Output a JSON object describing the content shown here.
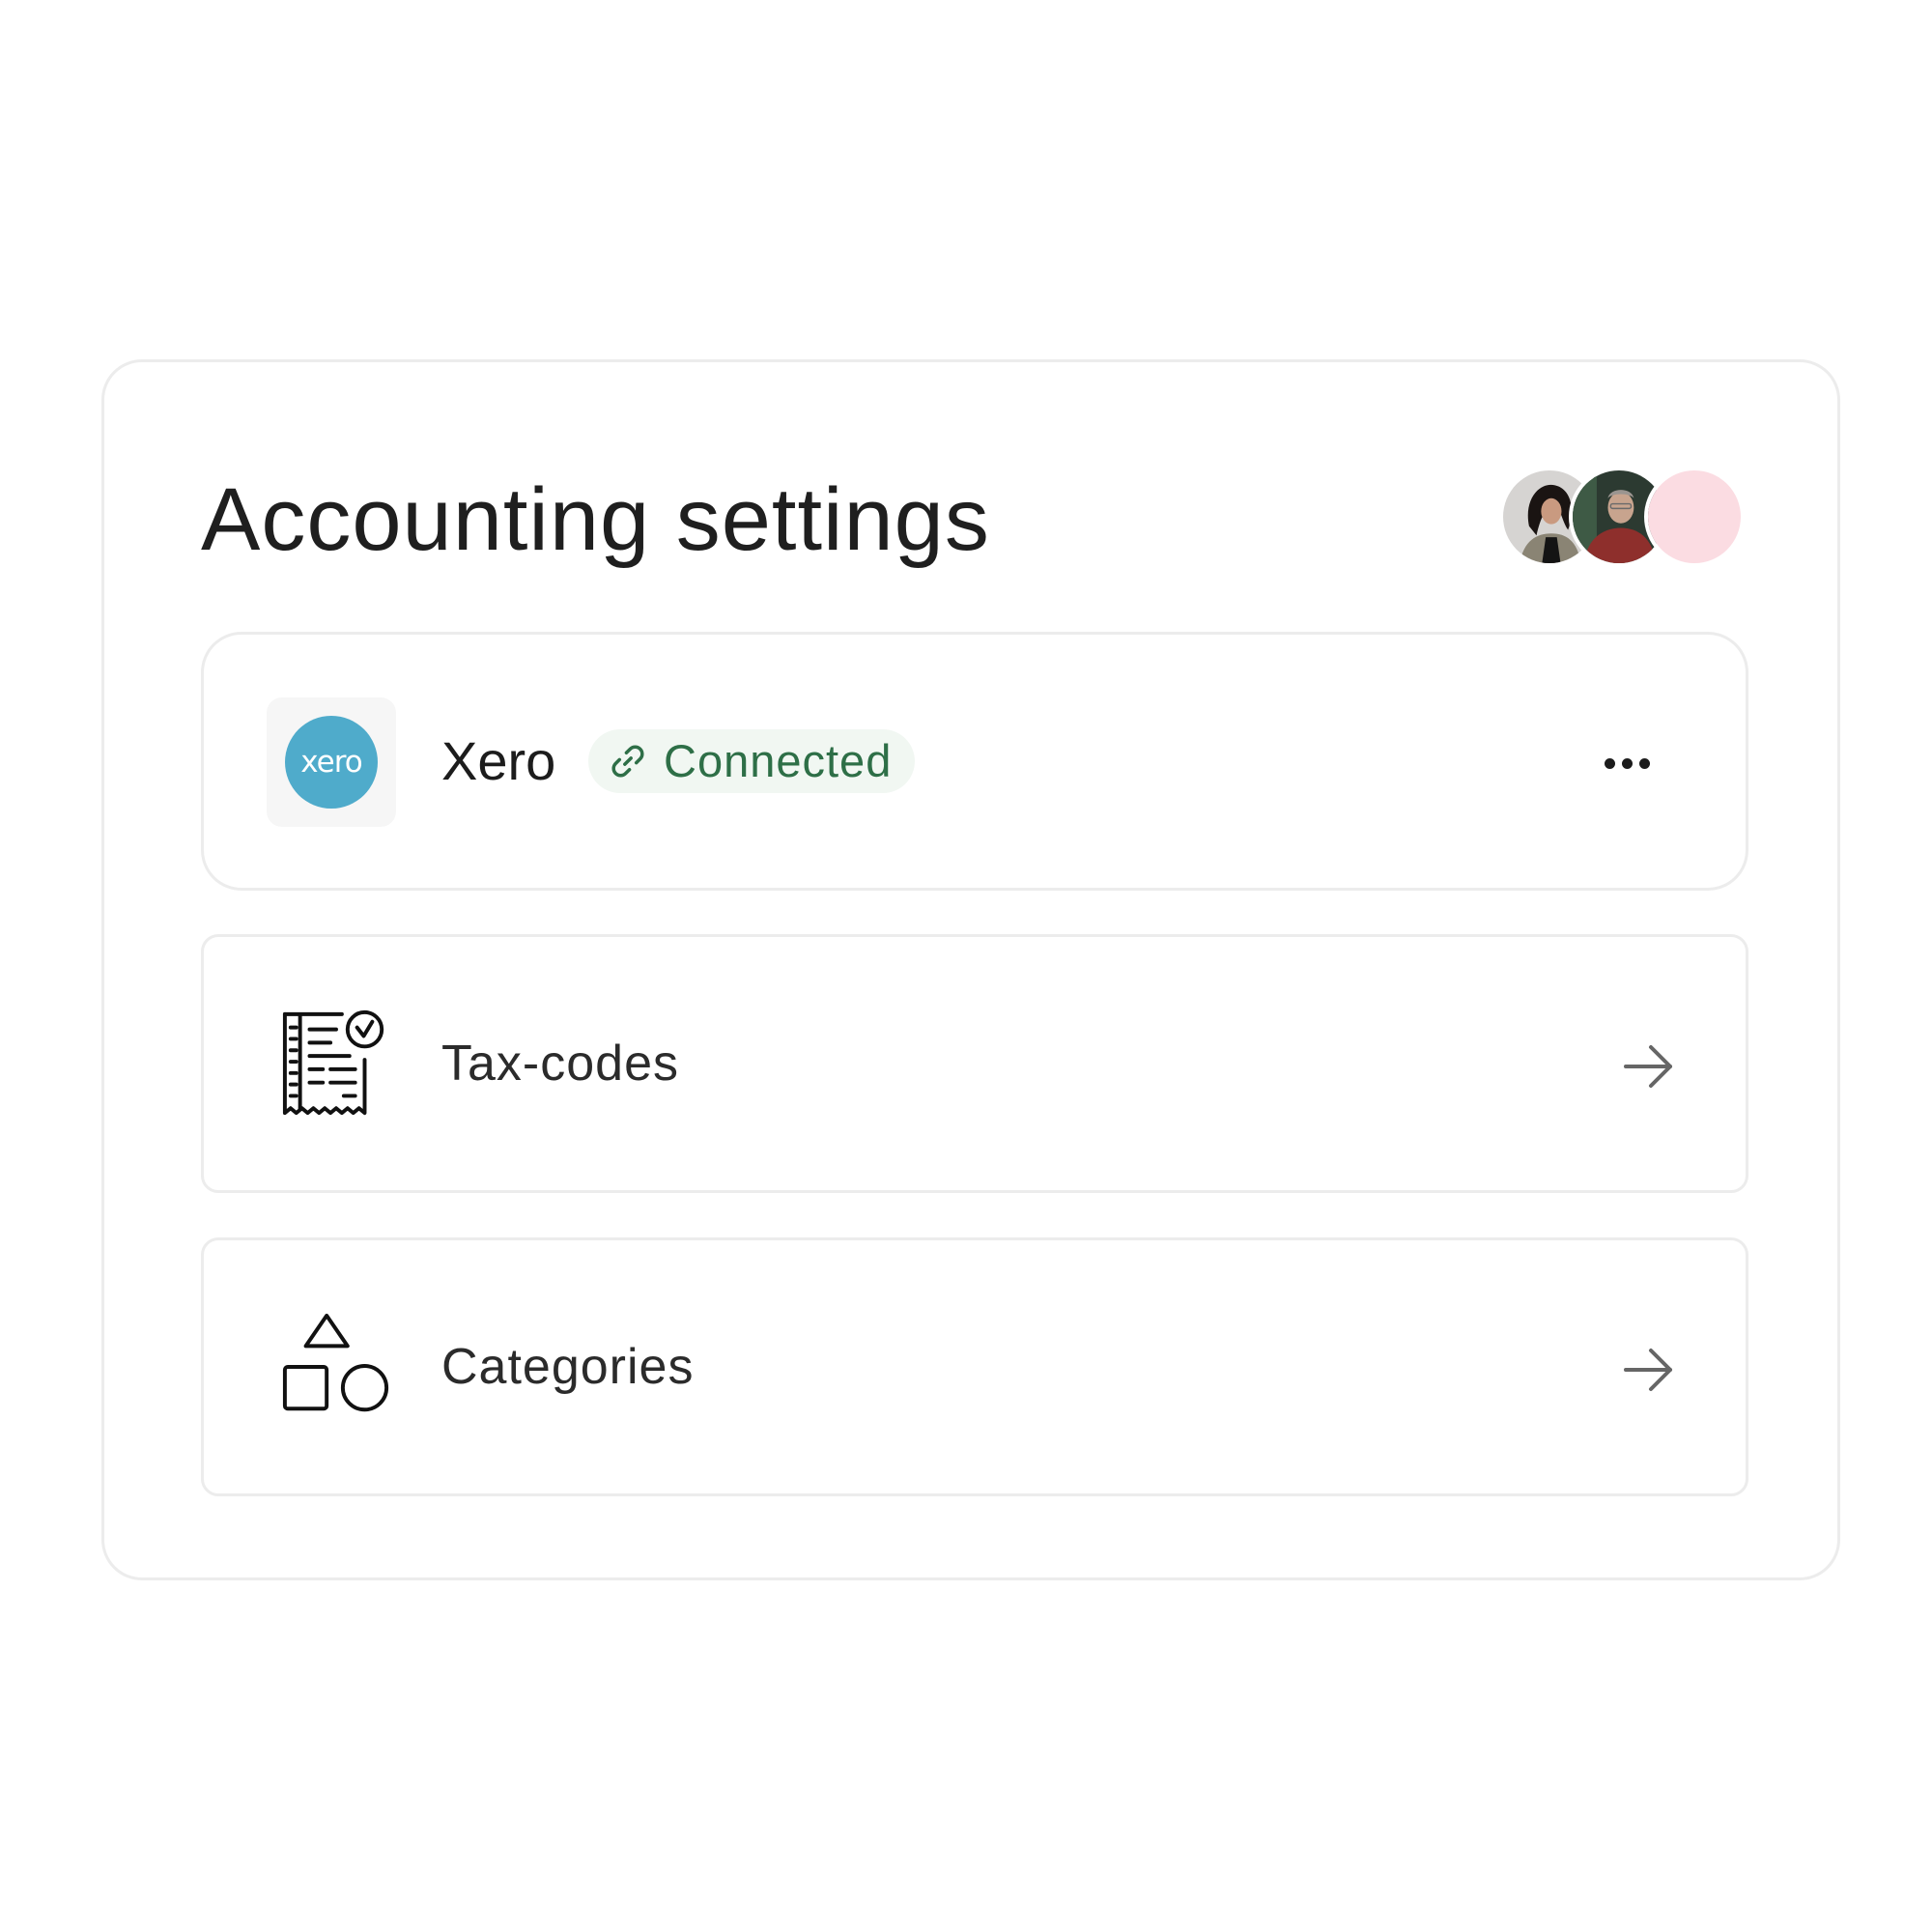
{
  "page": {
    "title": "Accounting settings"
  },
  "avatars": [
    {
      "name": "avatar-user-1",
      "bg": "#cfcfcf"
    },
    {
      "name": "avatar-user-2",
      "bg": "#2f3a33"
    },
    {
      "name": "avatar-user-3",
      "bg": "#fbdce2"
    }
  ],
  "integration": {
    "logo_text": "xero",
    "name": "Xero",
    "status": "Connected",
    "status_icon": "link-icon",
    "menu_icon": "more-horizontal-icon",
    "colors": {
      "logo": "#4fabcb",
      "status_text": "#2e6f47",
      "status_bg": "#f1f7f2"
    }
  },
  "items": [
    {
      "label": "Tax-codes",
      "icon": "receipt-check-icon",
      "action_icon": "arrow-right-icon"
    },
    {
      "label": "Categories",
      "icon": "shapes-icon",
      "action_icon": "arrow-right-icon"
    }
  ]
}
